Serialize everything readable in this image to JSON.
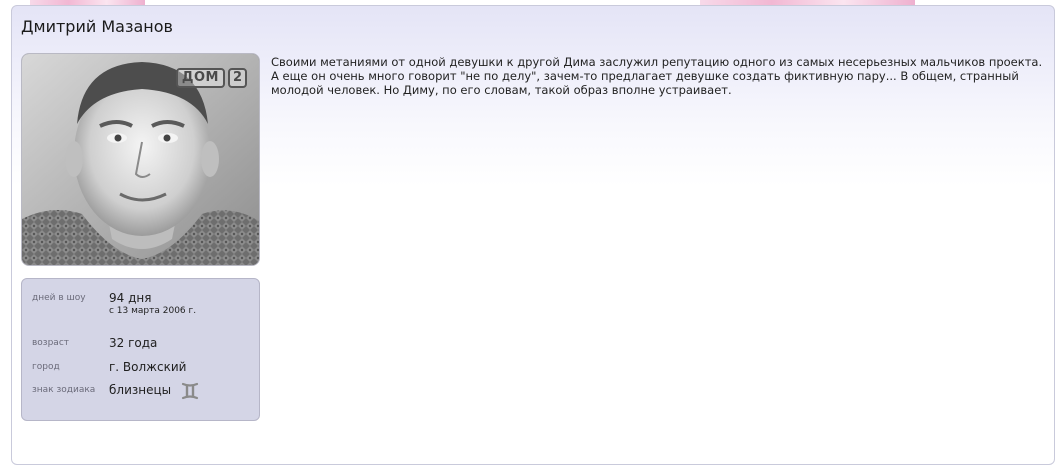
{
  "participant": {
    "name": "Дмитрий Мазанов",
    "photo_logo": {
      "text": "ДОМ",
      "number": "2"
    },
    "description": "Своими метаниями от одной девушки к другой Дима заслужил репутацию одного из самых несерьезных мальчиков проекта. А еще он очень много говорит \"не по делу\", зачем-то предлагает девушке создать фиктивную пару... В общем, странный молодой человек. Но Диму, по его словам, такой образ вполне устраивает."
  },
  "info": {
    "days": {
      "label": "дней в шоу",
      "value": "94 дня",
      "since": "с 13 марта 2006 г."
    },
    "age": {
      "label": "возраст",
      "value": "32 года"
    },
    "city": {
      "label": "город",
      "value": "г. Волжский"
    },
    "zodiac": {
      "label": "знак зодиака",
      "value": "близнецы",
      "icon": "gemini-icon"
    }
  },
  "colors": {
    "card_border": "#c9cadb",
    "header_gradient": "#e4e4f6",
    "info_bg": "#d4d5e6",
    "icon_gray": "#8a8a8a"
  }
}
